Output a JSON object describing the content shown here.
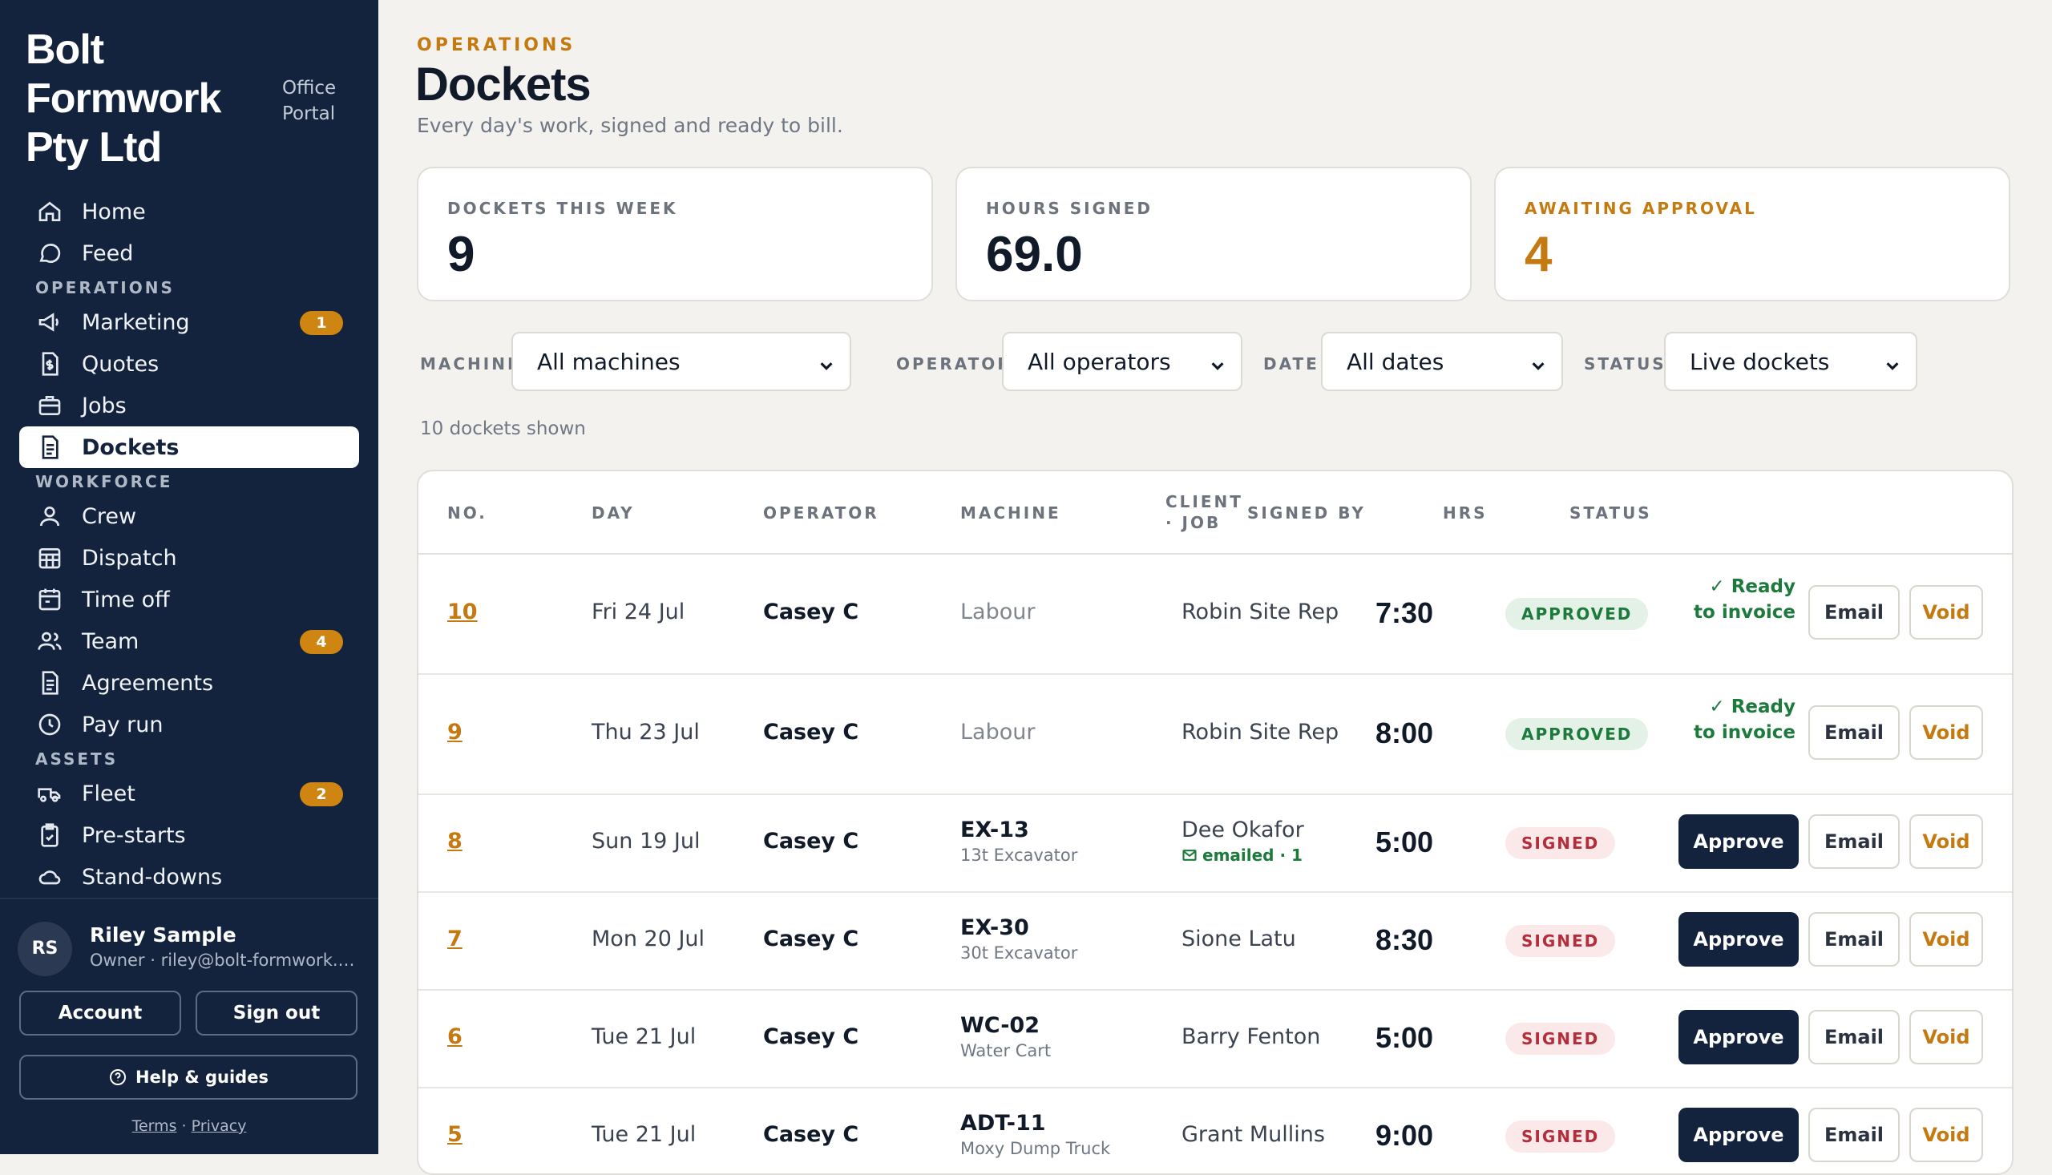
{
  "brand": {
    "name": "Bolt Formwork Pty Ltd",
    "portal": "Office Portal"
  },
  "nav": {
    "top": [
      {
        "label": "Home",
        "icon": "home-icon"
      },
      {
        "label": "Feed",
        "icon": "chat-icon"
      }
    ],
    "operations_label": "OPERATIONS",
    "operations": [
      {
        "label": "Marketing",
        "icon": "megaphone-icon",
        "badge": "1"
      },
      {
        "label": "Quotes",
        "icon": "dollar-doc-icon"
      },
      {
        "label": "Jobs",
        "icon": "briefcase-icon"
      },
      {
        "label": "Dockets",
        "icon": "document-icon",
        "active": true
      }
    ],
    "workforce_label": "WORKFORCE",
    "workforce": [
      {
        "label": "Crew",
        "icon": "person-icon"
      },
      {
        "label": "Dispatch",
        "icon": "grid-calendar-icon"
      },
      {
        "label": "Time off",
        "icon": "calendar-icon"
      },
      {
        "label": "Team",
        "icon": "people-icon",
        "badge": "4"
      },
      {
        "label": "Agreements",
        "icon": "document-icon"
      },
      {
        "label": "Pay run",
        "icon": "clock-icon"
      }
    ],
    "assets_label": "ASSETS",
    "assets": [
      {
        "label": "Fleet",
        "icon": "truck-icon",
        "badge": "2"
      },
      {
        "label": "Pre-starts",
        "icon": "clipboard-icon"
      },
      {
        "label": "Stand-downs",
        "icon": "cloud-icon"
      }
    ]
  },
  "user": {
    "initials": "RS",
    "name": "Riley Sample",
    "meta": "Owner · riley@bolt-formwork.example"
  },
  "footer": {
    "account": "Account",
    "signout": "Sign out",
    "help": "Help & guides",
    "terms": "Terms",
    "sep": " · ",
    "privacy": "Privacy"
  },
  "page": {
    "eyebrow": "OPERATIONS",
    "title": "Dockets",
    "subtitle": "Every day's work, signed and ready to bill."
  },
  "stats": [
    {
      "label": "DOCKETS THIS WEEK",
      "value": "9"
    },
    {
      "label": "HOURS SIGNED",
      "value": "69.0"
    },
    {
      "label": "AWAITING APPROVAL",
      "value": "4"
    }
  ],
  "filters": {
    "machine_label": "MACHINE",
    "machine_value": "All machines",
    "operator_label": "OPERATOR",
    "operator_value": "All operators",
    "date_label": "DATE",
    "date_value": "All dates",
    "status_label": "STATUS",
    "status_value": "Live dockets"
  },
  "shown": "10 dockets shown",
  "table": {
    "headers": {
      "no": "NO.",
      "day": "DAY",
      "operator": "OPERATOR",
      "machine": "MACHINE",
      "client1": "CLIENT",
      "client2": "· JOB",
      "signed": "SIGNED BY",
      "hrs": "HRS",
      "status": "STATUS"
    },
    "ready_text": "✓ Ready to invoice",
    "approve": "Approve",
    "email": "Email",
    "void": "Void",
    "rows": [
      {
        "no": "10",
        "day": "Fri 24 Jul",
        "operator": "Casey C",
        "machine": "Labour",
        "machine_desc": "",
        "signed_by": "Robin Site Rep",
        "emailed": "",
        "hrs": "7:30",
        "status": "APPROVED"
      },
      {
        "no": "9",
        "day": "Thu 23 Jul",
        "operator": "Casey C",
        "machine": "Labour",
        "machine_desc": "",
        "signed_by": "Robin Site Rep",
        "emailed": "",
        "hrs": "8:00",
        "status": "APPROVED"
      },
      {
        "no": "8",
        "day": "Sun 19 Jul",
        "operator": "Casey C",
        "machine": "EX-13",
        "machine_desc": "13t Excavator",
        "signed_by": "Dee Okafor",
        "emailed": "emailed · 1",
        "hrs": "5:00",
        "status": "SIGNED"
      },
      {
        "no": "7",
        "day": "Mon 20 Jul",
        "operator": "Casey C",
        "machine": "EX-30",
        "machine_desc": "30t Excavator",
        "signed_by": "Sione Latu",
        "emailed": "",
        "hrs": "8:30",
        "status": "SIGNED"
      },
      {
        "no": "6",
        "day": "Tue 21 Jul",
        "operator": "Casey C",
        "machine": "WC-02",
        "machine_desc": "Water Cart",
        "signed_by": "Barry Fenton",
        "emailed": "",
        "hrs": "5:00",
        "status": "SIGNED"
      },
      {
        "no": "5",
        "day": "Tue 21 Jul",
        "operator": "Casey C",
        "machine": "ADT-11",
        "machine_desc": "Moxy Dump Truck",
        "signed_by": "Grant Mullins",
        "emailed": "",
        "hrs": "9:00",
        "status": "SIGNED"
      }
    ]
  }
}
